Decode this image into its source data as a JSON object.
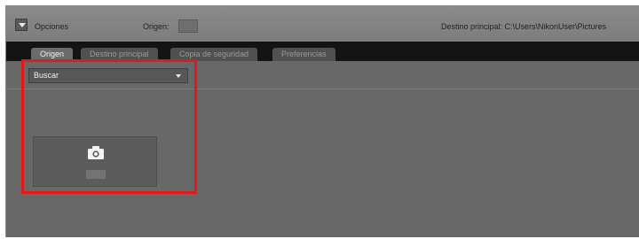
{
  "header": {
    "options_label": "Opciones",
    "origin_label": "Origen:",
    "destination_text": "Destino principal: C:\\Users\\NikonUser\\Pictures"
  },
  "tabs": [
    {
      "label": "Origen",
      "active": true
    },
    {
      "label": "Destino principal",
      "active": false
    },
    {
      "label": "Copia de seguridad",
      "active": false
    },
    {
      "label": "Preferencias",
      "active": false
    }
  ],
  "source": {
    "dropdown_value": "Buscar",
    "device_icon": "camera-icon"
  },
  "colors": {
    "highlight": "#e51919",
    "panel": "#686868",
    "tabstrip": "#141414"
  }
}
